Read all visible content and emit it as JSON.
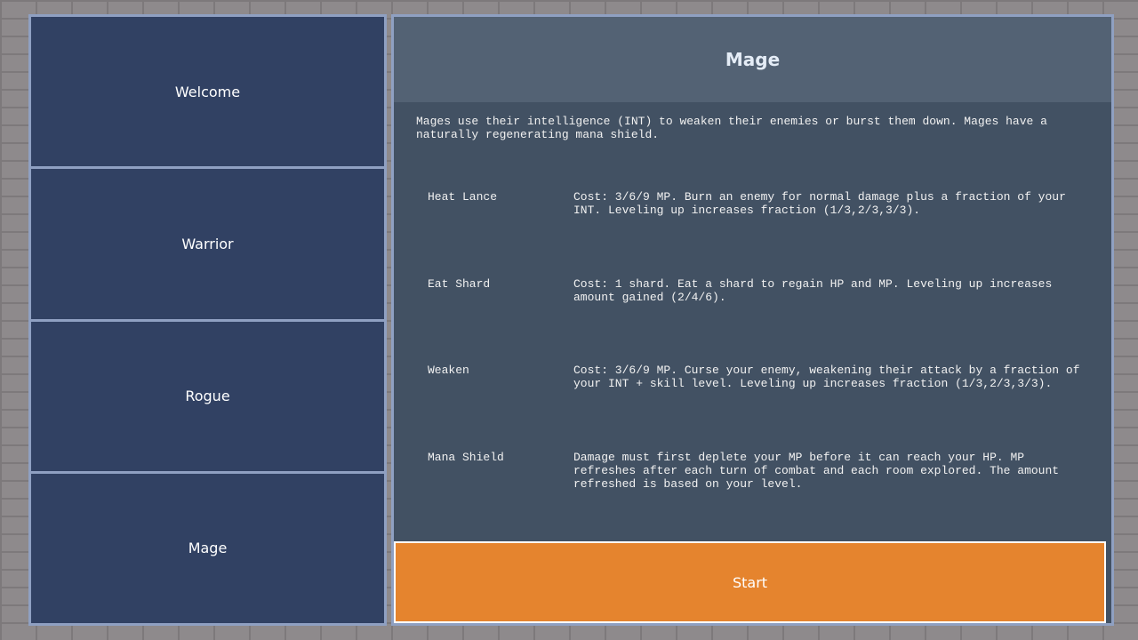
{
  "sidebar": {
    "tabs": [
      {
        "label": "Welcome"
      },
      {
        "label": "Warrior"
      },
      {
        "label": "Rogue"
      },
      {
        "label": "Mage"
      }
    ]
  },
  "panel": {
    "title": "Mage",
    "description": "Mages use their intelligence (INT) to weaken their enemies or burst them down. Mages have a\nnaturally regenerating mana shield.",
    "skills": [
      {
        "name": "Heat Lance",
        "desc": "Cost: 3/6/9 MP. Burn an enemy for normal damage plus a fraction of your\nINT. Leveling up increases fraction (1/3,2/3,3/3)."
      },
      {
        "name": "Eat Shard",
        "desc": "Cost: 1 shard. Eat a shard to regain HP and MP. Leveling up increases\namount gained (2/4/6)."
      },
      {
        "name": "Weaken",
        "desc": "Cost: 3/6/9 MP. Curse your enemy, weakening their attack by a fraction of\nyour INT + skill level. Leveling up increases fraction (1/3,2/3,3/3)."
      },
      {
        "name": "Mana Shield",
        "desc": "Damage must first deplete your MP before it can reach your HP. MP\nrefreshes after each turn of combat and each room explored. The amount\nrefreshed is based on your level."
      }
    ],
    "start_label": "Start"
  }
}
